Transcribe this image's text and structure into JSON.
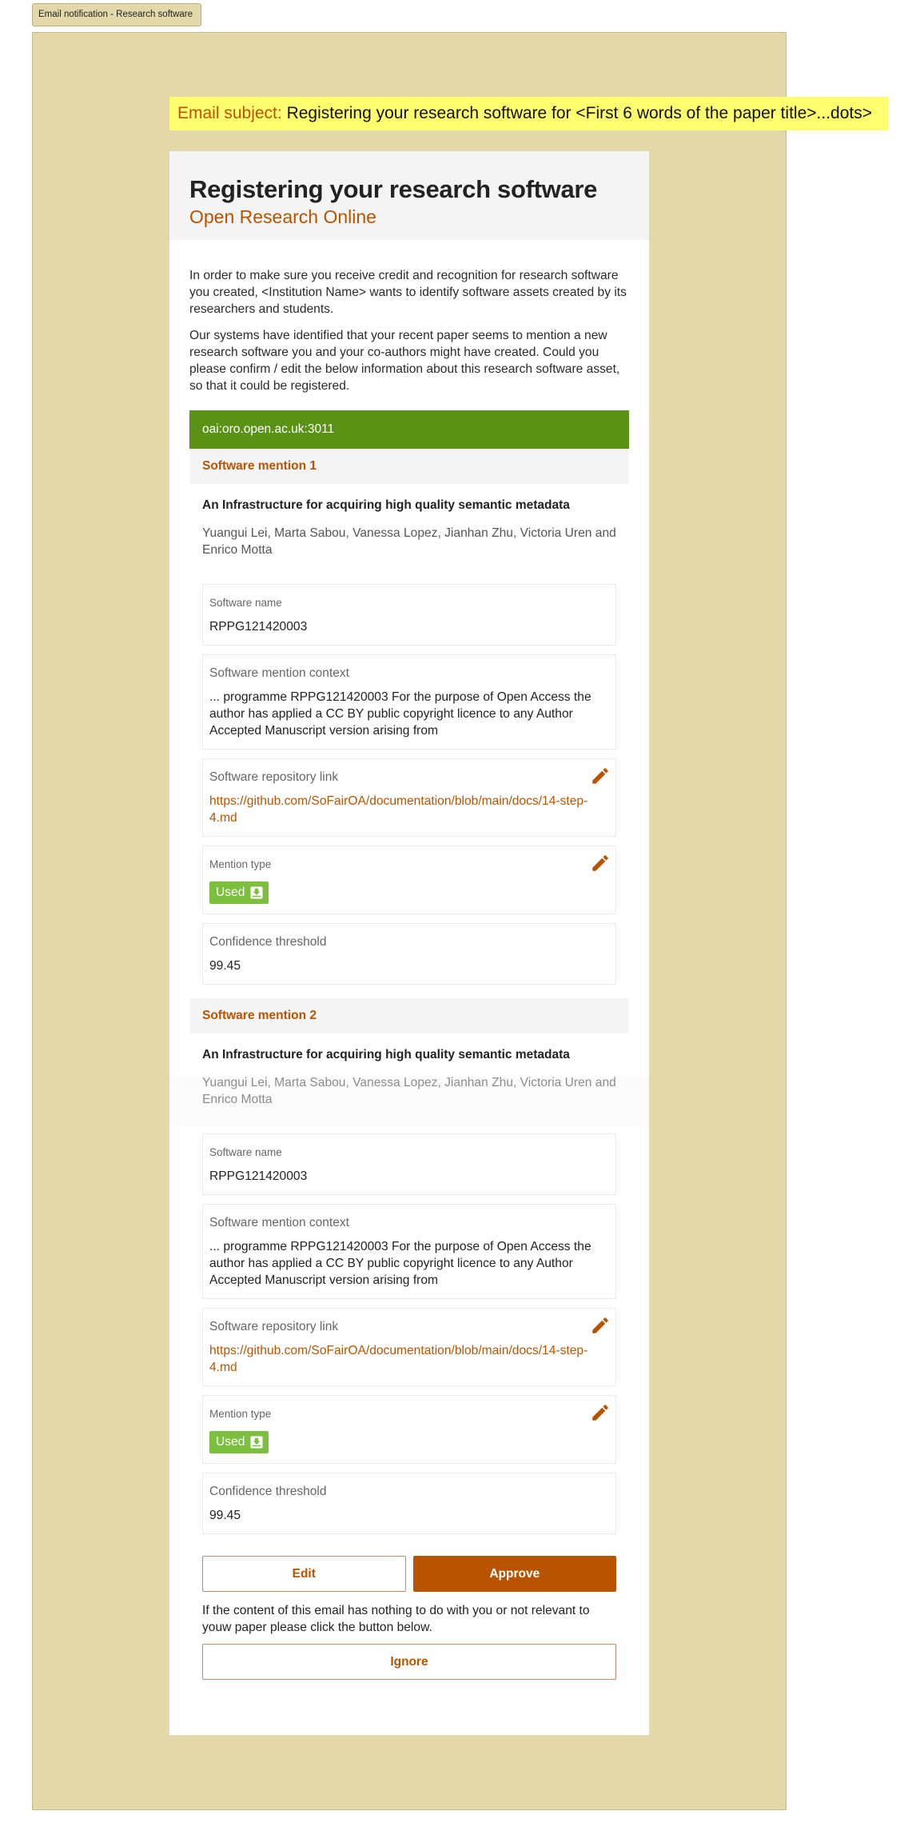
{
  "tab": {
    "label": "Email notification  - Research software"
  },
  "subject": {
    "label": "Email subject:",
    "text": "Registering your research software for <First 6 words of the paper title>...dots>"
  },
  "header": {
    "title": "Registering your research software",
    "subtitle": "Open Research Online"
  },
  "intro": [
    "In order to make sure you receive credit and recognition for research software you created, <Institution Name> wants to identify software assets created by its researchers and students.",
    "Our systems have identified that your recent paper seems to mention a new research software you and your co-authors might have created. Could you please confirm / edit the below information about this research software asset, so that it could be registered."
  ],
  "record_id": "oai:oro.open.ac.uk:3011",
  "mentions": [
    {
      "heading": "Software mention 1",
      "paper_title": "An Infrastructure for acquiring high quality semantic metadata",
      "authors": "Yuangui Lei, Marta Sabou, Vanessa Lopez, Jianhan Zhu, Victoria Uren and Enrico Motta",
      "fields": {
        "name_label": "Software name",
        "name_value": "RPPG121420003",
        "context_label": "Software mention context",
        "context_value": "... programme RPPG121420003 For the purpose of Open Access the author has applied a CC BY public copyright licence to any Author Accepted Manuscript version arising from",
        "repo_label": "Software repository link",
        "repo_value": "https://github.com/SoFairOA/documentation/blob/main/docs/14-step-4.md",
        "type_label": "Mention type",
        "type_value": "Used",
        "confidence_label": "Confidence threshold",
        "confidence_value": "99.45"
      }
    },
    {
      "heading": "Software mention 2",
      "paper_title": "An Infrastructure for acquiring high quality semantic metadata",
      "authors": "Yuangui Lei, Marta Sabou, Vanessa Lopez, Jianhan Zhu, Victoria Uren and Enrico Motta",
      "fields": {
        "name_label": "Software name",
        "name_value": "RPPG121420003",
        "context_label": "Software mention context",
        "context_value": "... programme RPPG121420003 For the purpose of Open Access the author has applied a CC BY public copyright licence to any Author Accepted Manuscript version arising from",
        "repo_label": "Software repository link",
        "repo_value": "https://github.com/SoFairOA/documentation/blob/main/docs/14-step-4.md",
        "type_label": "Mention type",
        "type_value": "Used",
        "confidence_label": "Confidence threshold",
        "confidence_value": "99.45"
      }
    }
  ],
  "actions": {
    "edit_label": "Edit",
    "approve_label": "Approve",
    "ignore_note": "If the content of this email has nothing to do with you or not relevant to youw paper please click the button below.",
    "ignore_label": "Ignore"
  },
  "icons": {
    "edit": "pencil-icon",
    "mention_type": "download-tray-icon"
  },
  "colors": {
    "accent": "#b85400",
    "record_bar": "#5a9216",
    "badge_used": "#7cbf3e",
    "frame_bg": "#e2d8aa",
    "subject_bg": "#fffe6f",
    "header_bg": "#f4f4f4"
  }
}
